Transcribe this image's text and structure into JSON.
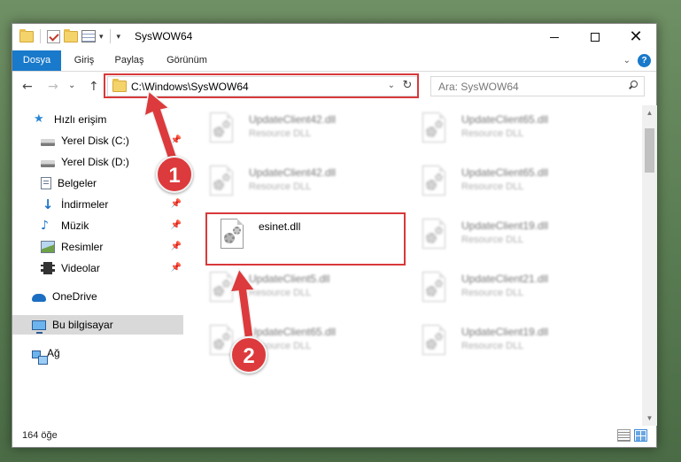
{
  "window": {
    "title": "SysWOW64",
    "min_label": "",
    "close_glyph": "✕"
  },
  "ribbon": {
    "tabs": [
      "Dosya",
      "Giriş",
      "Paylaş",
      "Görünüm"
    ],
    "help": "?"
  },
  "nav": {
    "back": "←",
    "forward": "→",
    "recent": "⌄",
    "up": "↑",
    "address": "C:\\Windows\\SysWOW64",
    "refresh": "↻",
    "search_placeholder": "Ara: SysWOW64"
  },
  "sidebar": {
    "items": [
      {
        "label": "Hızlı erişim",
        "icon": "star-icon"
      },
      {
        "label": "Yerel Disk (C:)",
        "icon": "disk-icon",
        "pinned": true
      },
      {
        "label": "Yerel Disk (D:)",
        "icon": "disk-icon"
      },
      {
        "label": "Belgeler",
        "icon": "document-icon",
        "pinned": true
      },
      {
        "label": "İndirmeler",
        "icon": "download-icon",
        "pinned": true
      },
      {
        "label": "Müzik",
        "icon": "music-icon",
        "pinned": true
      },
      {
        "label": "Resimler",
        "icon": "pictures-icon",
        "pinned": true
      },
      {
        "label": "Videolar",
        "icon": "video-icon",
        "pinned": true
      },
      {
        "label": "OneDrive",
        "icon": "cloud-icon"
      },
      {
        "label": "Bu bilgisayar",
        "icon": "computer-icon",
        "selected": true
      },
      {
        "label": "Ağ",
        "icon": "network-icon"
      }
    ],
    "pin_glyph": "📌"
  },
  "files": [
    {
      "name": "UpdateClient42.dll",
      "type": "Resource DLL"
    },
    {
      "name": "UpdateClient65.dll",
      "type": "Resource DLL"
    },
    {
      "name": "UpdateClient42.dll",
      "type": "Resource DLL"
    },
    {
      "name": "UpdateClient65.dll",
      "type": "Resource DLL"
    },
    {
      "name": "esinet.dll",
      "type": ""
    },
    {
      "name": "UpdateClient19.dll",
      "type": "Resource DLL"
    },
    {
      "name": "UpdateClient5.dll",
      "type": "Resource DLL"
    },
    {
      "name": "UpdateClient21.dll",
      "type": "Resource DLL"
    },
    {
      "name": "UpdateClient65.dll",
      "type": "Resource DLL"
    },
    {
      "name": "UpdateClient19.dll",
      "type": "Resource DLL"
    }
  ],
  "status": {
    "count": "164 öğe"
  },
  "annotations": {
    "badge1": "1",
    "badge2": "2",
    "color": "#d8393b"
  }
}
